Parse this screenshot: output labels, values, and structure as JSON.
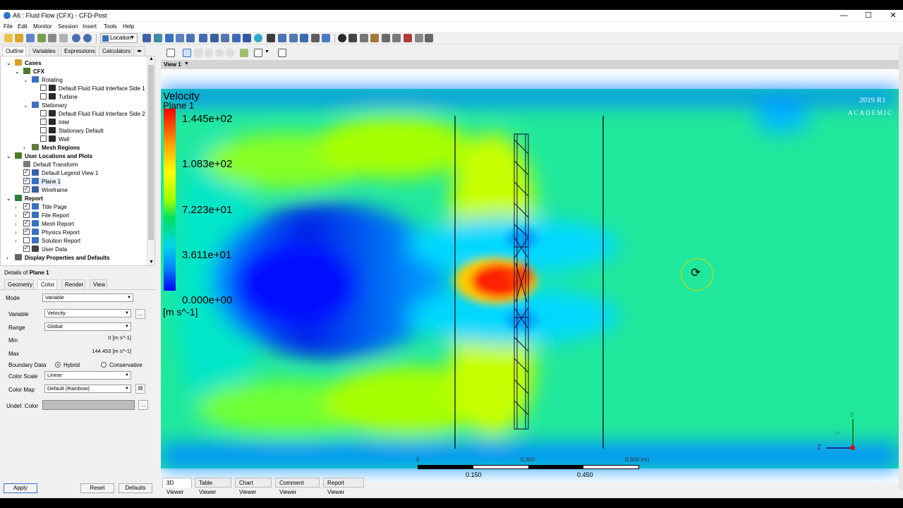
{
  "window": {
    "title": "A6 : Fluid Flow (CFX) - CFD-Post",
    "controls": [
      "—",
      "☐",
      "✕"
    ]
  },
  "menu": [
    "File",
    "Edit",
    "Monitor",
    "Session",
    "Insert",
    "Tools",
    "Help"
  ],
  "toolbar": {
    "location_label": "Location"
  },
  "panel_tabs": [
    "Outline",
    "Variables",
    "Expressions",
    "Calculators"
  ],
  "tree": [
    {
      "label": "Cases",
      "level": 0,
      "bold": true,
      "expander": "⌄",
      "icon": "case-folder-icon",
      "checkbox": null
    },
    {
      "label": "CFX",
      "level": 1,
      "bold": true,
      "expander": "⌄",
      "icon": "cfx-case-icon",
      "checkbox": null
    },
    {
      "label": "Rotating",
      "level": 2,
      "bold": false,
      "expander": "⌄",
      "icon": "domain-icon",
      "checkbox": null
    },
    {
      "label": "Default Fluid Fluid Interface Side 1",
      "level": 3,
      "bold": false,
      "expander": "",
      "icon": "boundary-icon",
      "checkbox": false
    },
    {
      "label": "Turbine",
      "level": 3,
      "bold": false,
      "expander": "",
      "icon": "boundary-icon",
      "checkbox": false
    },
    {
      "label": "Stationary",
      "level": 2,
      "bold": false,
      "expander": "⌄",
      "icon": "domain-icon",
      "checkbox": null
    },
    {
      "label": "Default Fluid Fluid Interface Side 2 1",
      "level": 3,
      "bold": false,
      "expander": "",
      "icon": "boundary-icon",
      "checkbox": false
    },
    {
      "label": "Inlet",
      "level": 3,
      "bold": false,
      "expander": "",
      "icon": "boundary-icon",
      "checkbox": false
    },
    {
      "label": "Stationary Default",
      "level": 3,
      "bold": false,
      "expander": "",
      "icon": "boundary-icon",
      "checkbox": false
    },
    {
      "label": "Wall",
      "level": 3,
      "bold": false,
      "expander": "",
      "icon": "boundary-icon",
      "checkbox": false
    },
    {
      "label": "Mesh Regions",
      "level": 2,
      "bold": true,
      "expander": "›",
      "icon": "mesh-regions-icon",
      "checkbox": null
    },
    {
      "label": "User Locations and Plots",
      "level": 0,
      "bold": true,
      "expander": "⌄",
      "icon": "user-locations-icon",
      "checkbox": null
    },
    {
      "label": "Default Transform",
      "level": 1,
      "bold": false,
      "expander": "",
      "icon": "transform-icon",
      "checkbox": null
    },
    {
      "label": "Default Legend View 1",
      "level": 1,
      "bold": false,
      "expander": "",
      "icon": "legend-icon",
      "checkbox": true
    },
    {
      "label": "Plane 1",
      "level": 1,
      "bold": false,
      "expander": "",
      "icon": "plane-icon",
      "checkbox": true,
      "selected": true
    },
    {
      "label": "Wireframe",
      "level": 1,
      "bold": false,
      "expander": "",
      "icon": "wireframe-icon",
      "checkbox": true
    },
    {
      "label": "Report",
      "level": 0,
      "bold": true,
      "expander": "⌄",
      "icon": "report-icon",
      "checkbox": null
    },
    {
      "label": "Title Page",
      "level": 1,
      "bold": false,
      "expander": "›",
      "icon": "report-item-icon",
      "checkbox": true
    },
    {
      "label": "File Report",
      "level": 1,
      "bold": false,
      "expander": "›",
      "icon": "report-item-icon",
      "checkbox": true
    },
    {
      "label": "Mesh Report",
      "level": 1,
      "bold": false,
      "expander": "›",
      "icon": "report-item-icon",
      "checkbox": true
    },
    {
      "label": "Physics Report",
      "level": 1,
      "bold": false,
      "expander": "›",
      "icon": "report-item-icon",
      "checkbox": true
    },
    {
      "label": "Solution Report",
      "level": 1,
      "bold": false,
      "expander": "›",
      "icon": "report-item-icon",
      "checkbox": false
    },
    {
      "label": "User Data",
      "level": 1,
      "bold": false,
      "expander": "",
      "icon": "text-item-icon",
      "checkbox": true
    },
    {
      "label": "Display Properties and Defaults",
      "level": 0,
      "bold": true,
      "expander": "›",
      "icon": "display-props-icon",
      "checkbox": null
    }
  ],
  "details": {
    "prefix": "Details of ",
    "object": "Plane 1",
    "tabs": [
      "Geometry",
      "Color",
      "Render",
      "View"
    ],
    "active_tab": "Color",
    "mode_label": "Mode",
    "mode_value": "Variable",
    "variable_label": "Variable",
    "variable_value": "Velocity",
    "range_label": "Range",
    "range_value": "Global",
    "min_label": "Min",
    "min_value": "0 [m s^-1]",
    "max_label": "Max",
    "max_value": "144.453 [m s^-1]",
    "boundary_label": "Boundary Data",
    "boundary_hybrid": "Hybrid",
    "boundary_conservative": "Conservative",
    "scale_label": "Color Scale",
    "scale_value": "Linear",
    "map_label": "Color Map",
    "map_value": "Default (Rainbow)",
    "undef_label": "Undef. Color",
    "ellipsis": "...",
    "apply": "Apply",
    "reset": "Reset",
    "defaults": "Defaults"
  },
  "viewer": {
    "view_tab": "View 1",
    "legend": {
      "title": "Velocity",
      "subtitle": "Plane 1",
      "labels": [
        "1.445e+02",
        "1.083e+02",
        "7.223e+01",
        "3.611e+01",
        "0.000e+00"
      ],
      "unit": "[m s^-1]",
      "max": 144.5,
      "min": 0
    },
    "watermark": {
      "version": "2019 R1",
      "edition": "ACADEMIC"
    },
    "scale_ruler": {
      "top_labels": [
        "0",
        "0.300",
        "0.600 (m)"
      ],
      "bottom_labels": [
        "0.150",
        "0.450"
      ]
    },
    "axes": {
      "y": "Y",
      "z": "Z",
      "x": "X"
    },
    "colors": {
      "fast": "#ff2000",
      "medium": "#a8ff00",
      "free_stream": "#20e89c",
      "slow": "#0030ff"
    }
  },
  "bottom_tabs": [
    "3D Viewer",
    "Table Viewer",
    "Chart Viewer",
    "Comment Viewer",
    "Report Viewer"
  ]
}
